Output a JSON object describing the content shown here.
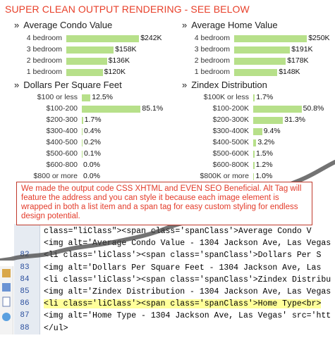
{
  "headline": "SUPER CLEAN OUTPUT RENDERING - SEE BELOW",
  "raquo": "»",
  "panels": {
    "condo": {
      "title": "Average Condo Value",
      "rows": [
        {
          "label": "4 bedroom",
          "value": "$242K",
          "fraction": 0.86
        },
        {
          "label": "3 bedroom",
          "value": "$158K",
          "fraction": 0.56
        },
        {
          "label": "2 bedroom",
          "value": "$136K",
          "fraction": 0.48
        },
        {
          "label": "1 bedroom",
          "value": "$120K",
          "fraction": 0.43
        }
      ]
    },
    "home": {
      "title": "Average Home Value",
      "rows": [
        {
          "label": "4 bedroom",
          "value": "$250K",
          "fraction": 0.86
        },
        {
          "label": "3 bedroom",
          "value": "$191K",
          "fraction": 0.66
        },
        {
          "label": "2 bedroom",
          "value": "$178K",
          "fraction": 0.61
        },
        {
          "label": "1 bedroom",
          "value": "$148K",
          "fraction": 0.51
        }
      ]
    },
    "dpsf": {
      "title": "Dollars Per Square Feet",
      "rows": [
        {
          "label": "$100 or less",
          "value": "12.5%",
          "fraction": 0.125
        },
        {
          "label": "$100-200",
          "value": "85.1%",
          "fraction": 0.851
        },
        {
          "label": "$200-300",
          "value": "1.7%",
          "fraction": 0.017
        },
        {
          "label": "$300-400",
          "value": "0.4%",
          "fraction": 0.004
        },
        {
          "label": "$400-500",
          "value": "0.2%",
          "fraction": 0.002
        },
        {
          "label": "$500-600",
          "value": "0.1%",
          "fraction": 0.001
        },
        {
          "label": "$600-800",
          "value": "0.0%",
          "fraction": 0.0
        },
        {
          "label": "$800 or more",
          "value": "0.0%",
          "fraction": 0.0
        }
      ]
    },
    "zindex": {
      "title": "Zindex Distribution",
      "rows": [
        {
          "label": "$100K or less",
          "value": "1.7%",
          "fraction": 0.017
        },
        {
          "label": "$100-200K",
          "value": "50.8%",
          "fraction": 0.508
        },
        {
          "label": "$200-300K",
          "value": "31.3%",
          "fraction": 0.313
        },
        {
          "label": "$300-400K",
          "value": "9.4%",
          "fraction": 0.094
        },
        {
          "label": "$400-500K",
          "value": "3.2%",
          "fraction": 0.032
        },
        {
          "label": "$500-600K",
          "value": "1.5%",
          "fraction": 0.015
        },
        {
          "label": "$600-800K",
          "value": "1.2%",
          "fraction": 0.012
        },
        {
          "label": "$800K or more",
          "value": "1.0%",
          "fraction": 0.01
        }
      ]
    }
  },
  "callout": "We made the output code CSS XHTML and EVEN SEO Beneficial. Alt Tag will feature the address and you can style it because each image element is wrapped in both a list item and a span tag for easy custom styling for endless design potential.",
  "code": {
    "lines": [
      {
        "num": "",
        "text": "class=\"liClass\"><span class='spanClass'>Average Condo V"
      },
      {
        "num": "",
        "text": "<img alt='Average Condo Value - 1304 Jackson Ave, Las Vegas"
      },
      {
        "num": "82",
        "text": "<li class='liClass'><span class='spanClass'>Dollars Per S"
      },
      {
        "num": "83",
        "text": "<img alt='Dollars Per Square Feet - 1304 Jackson Ave, Las"
      },
      {
        "num": "84",
        "text": "<li class='liClass'><span class='spanClass'>Zindex Distribu"
      },
      {
        "num": "85",
        "text": "<img alt='Zindex Distribution - 1304 Jackson Ave, Las Vegas"
      },
      {
        "num": "86",
        "text": "<li class='liClass'><span class='spanClass'>Home Type<br>"
      },
      {
        "num": "87",
        "text": "<img alt='Home Type - 1304 Jackson Ave, Las Vegas' src='htt"
      },
      {
        "num": "88",
        "text": "</ul>"
      }
    ]
  }
}
